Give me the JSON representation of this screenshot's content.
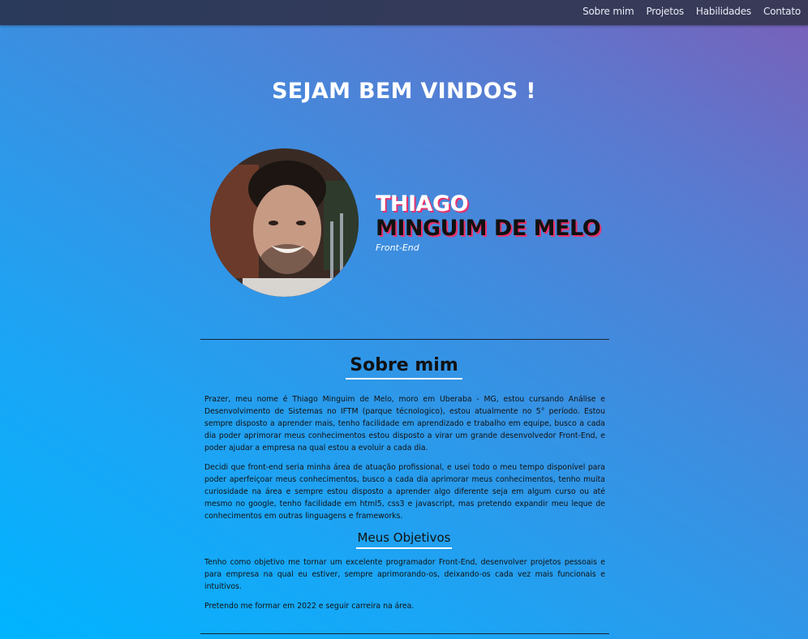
{
  "nav": {
    "items": [
      {
        "label": "Sobre mim"
      },
      {
        "label": "Projetos"
      },
      {
        "label": "Habilidades"
      },
      {
        "label": "Contato"
      }
    ]
  },
  "hero": {
    "welcome": "SEJAM BEM VINDOS !",
    "name_first": "THIAGO",
    "name_last": "MINGUIM DE MELO",
    "role": "Front-End"
  },
  "about": {
    "title": "Sobre mim",
    "paragraphs": [
      "Prazer, meu nome é Thiago Minguim de Melo, moro em Uberaba - MG, estou cursando Análise e Desenvolvimento de Sistemas no IFTM (parque técnologico), estou atualmente no 5° período. Estou sempre disposto a aprender mais, tenho facilidade em aprendizado e trabalho em equipe, busco a cada dia poder aprimorar meus conhecimentos estou disposto a virar um grande desenvolvedor Front-End, e poder ajudar a empresa na qual estou a evoluir a cada dia.",
      "Decidi que front-end seria minha área de atuação profissional, e usei todo o meu tempo disponível para poder aperfeiçoar meus conhecimentos, busco a cada dia aprimorar meus conhecimentos, tenho muita curiosidade na área e sempre estou disposto a aprender algo diferente seja em algum curso ou até mesmo no google, tenho facilidade em html5, css3 e javascript, mas pretendo expandir meu leque de conhecimentos em outras linguagens e frameworks."
    ]
  },
  "objectives": {
    "title": "Meus Objetivos",
    "paragraphs": [
      "Tenho como objetivo me tornar um excelente programador Front-End, desenvolver projetos pessoais e para empresa na qual eu estiver, sempre aprimorando-os, deixando-os cada vez mais funcionais e intuitivos.",
      "Pretendo me formar em 2022 e seguir carreira na área."
    ]
  },
  "colors": {
    "name_shadow": "#e8336d",
    "topbar": "#2f3a5a",
    "gradient_start": "#00b4ff",
    "gradient_end": "#7a5fb8"
  }
}
